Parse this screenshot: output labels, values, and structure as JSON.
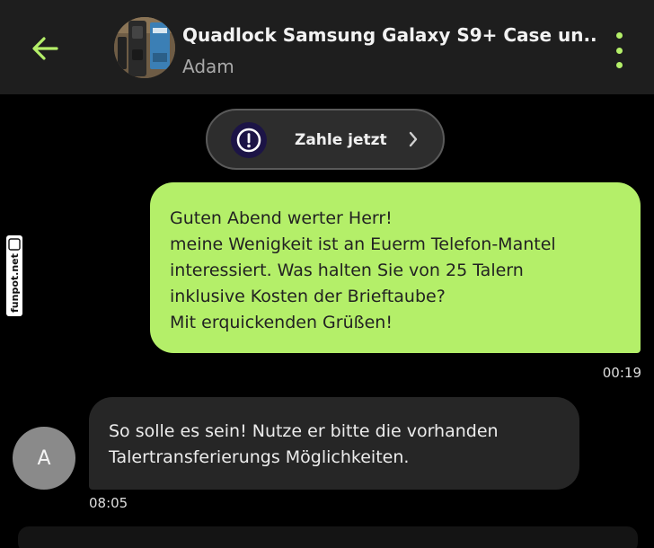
{
  "header": {
    "back_icon": "arrow-left-icon",
    "thumbnail_icon": "product-thumbnail",
    "title": "Quadlock Samsung Galaxy S9+ Case un...",
    "subtitle": "Adam",
    "menu_icon": "more-vertical-icon"
  },
  "pay_button": {
    "icon": "exclamation-circle-icon",
    "label": "Zahle jetzt",
    "chevron_icon": "chevron-right-icon"
  },
  "messages": [
    {
      "direction": "outgoing",
      "text": "Guten Abend werter Herr!\nmeine Wenigkeit ist an Euerm Telefon-Mantel\ninteressiert. Was halten Sie von 25 Talern\ninklusive Kosten der Brieftaube?\nMit erquickenden Grüßen!",
      "time": "00:19"
    },
    {
      "direction": "incoming",
      "avatar_letter": "A",
      "text": "So solle es sein! Nutze er bitte die vorhanden\nTalertransferierungs Möglichkeiten.",
      "time": "08:05"
    }
  ],
  "watermark": "funpot.net",
  "colors": {
    "accent": "#b4ef69",
    "header_bg": "#1e1e1e",
    "incoming_bubble": "#262626",
    "page_bg": "#000000"
  }
}
